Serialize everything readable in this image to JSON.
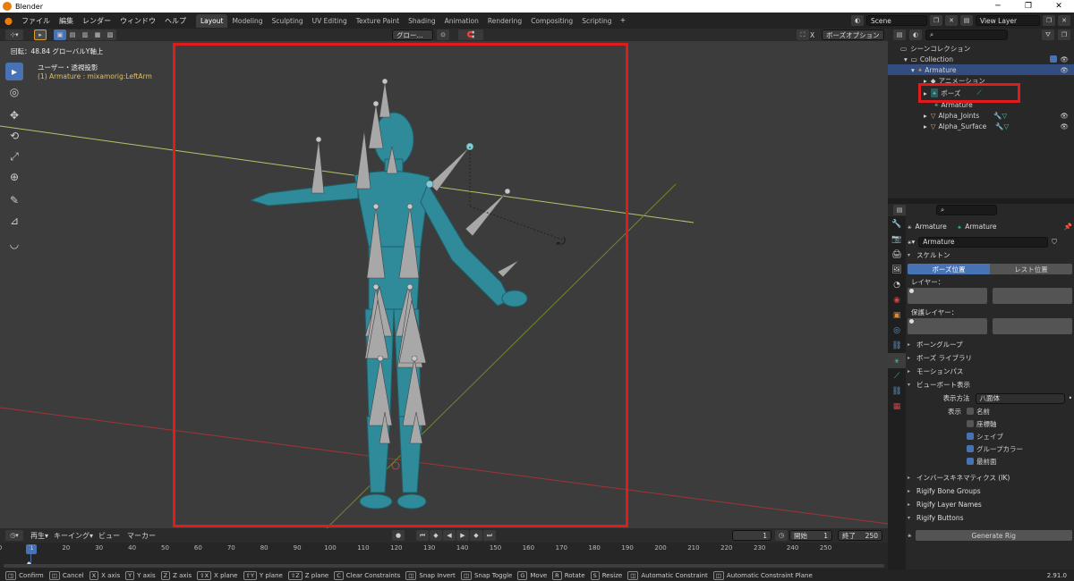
{
  "window": {
    "title": "Blender",
    "controls": [
      "─",
      "❐",
      "✕"
    ]
  },
  "menu": [
    "ファイル",
    "編集",
    "レンダー",
    "ウィンドウ",
    "ヘルプ"
  ],
  "workspaces": [
    "Layout",
    "Modeling",
    "Sculpting",
    "UV Editing",
    "Texture Paint",
    "Shading",
    "Animation",
    "Rendering",
    "Compositing",
    "Scripting"
  ],
  "active_workspace": "Layout",
  "scene": "Scene",
  "view_layer": "View Layer",
  "viewport": {
    "transform_orientation": "グロー...",
    "pose_options": "ボーズオプション",
    "x_label": "X",
    "rotation_info": "回転：48.84 グローバルY軸上",
    "view_name": "ユーザー・透視投影",
    "object_info": "(1) Armature : mixamorig:LeftArm"
  },
  "outliner": {
    "root": "シーンコレクション",
    "rows": [
      {
        "label": "Collection"
      },
      {
        "label": "Armature",
        "selected": true
      },
      {
        "label": "アニメーション"
      },
      {
        "label": "ポーズ"
      },
      {
        "label": "Armature"
      },
      {
        "label": "Alpha_Joints"
      },
      {
        "label": "Alpha_Surface"
      }
    ]
  },
  "properties": {
    "breadcrumb_object": "Armature",
    "breadcrumb_data": "Armature",
    "datablock": "Armature",
    "skeleton": "スケルトン",
    "pose_position": "ボーズ位置",
    "rest_position": "レスト位置",
    "layers": "レイヤー：",
    "protected_layers": "保護レイヤー：",
    "bone_groups": "ボーングループ",
    "pose_library": "ボーズ ライブラリ",
    "motion_paths": "モーションパス",
    "viewport_display": "ビューボート表示",
    "display_as_label": "表示方法",
    "display_as": "八面体",
    "show_label": "表示",
    "checks": [
      {
        "label": "名前",
        "on": false
      },
      {
        "label": "座標軸",
        "on": false
      },
      {
        "label": "シェイブ",
        "on": true
      },
      {
        "label": "グループカラー",
        "on": true
      },
      {
        "label": "最前面",
        "on": true
      }
    ],
    "ik": "インバースキネマティクス (IK)",
    "rigify_groups": "Rigify Bone Groups",
    "rigify_layers": "Rigify Layer Names",
    "rigify_buttons": "Rigify Buttons",
    "generate": "Generate Rig"
  },
  "timeline": {
    "playback": "再生",
    "keying": "キーイング",
    "view": "ビュー",
    "marker": "マーカー",
    "current_frame": "1",
    "start_label": "開始",
    "start": "1",
    "end_label": "終了",
    "end": "250",
    "ticks": [
      "0",
      "10",
      "20",
      "30",
      "40",
      "50",
      "60",
      "70",
      "80",
      "90",
      "100",
      "110",
      "120",
      "130",
      "140",
      "150",
      "160",
      "170",
      "180",
      "190",
      "200",
      "210",
      "220",
      "230",
      "240",
      "250"
    ],
    "marker_frame": "1"
  },
  "status": {
    "items": [
      [
        "",
        "Confirm"
      ],
      [
        "",
        "Cancel"
      ],
      [
        "X",
        "X axis"
      ],
      [
        "Y",
        "Y axis"
      ],
      [
        "Z",
        "Z axis"
      ],
      [
        "⇧X",
        "X plane"
      ],
      [
        "⇧Y",
        "Y plane"
      ],
      [
        "⇧Z",
        "Z plane"
      ],
      [
        "C",
        "Clear Constraints"
      ],
      [
        "",
        "Snap Invert"
      ],
      [
        "",
        "Snap Toggle"
      ],
      [
        "G",
        "Move"
      ],
      [
        "R",
        "Rotate"
      ],
      [
        "S",
        "Resize"
      ],
      [
        "",
        "Automatic Constraint"
      ],
      [
        "",
        "Automatic Constraint Plane"
      ]
    ],
    "version": "2.91.0"
  }
}
